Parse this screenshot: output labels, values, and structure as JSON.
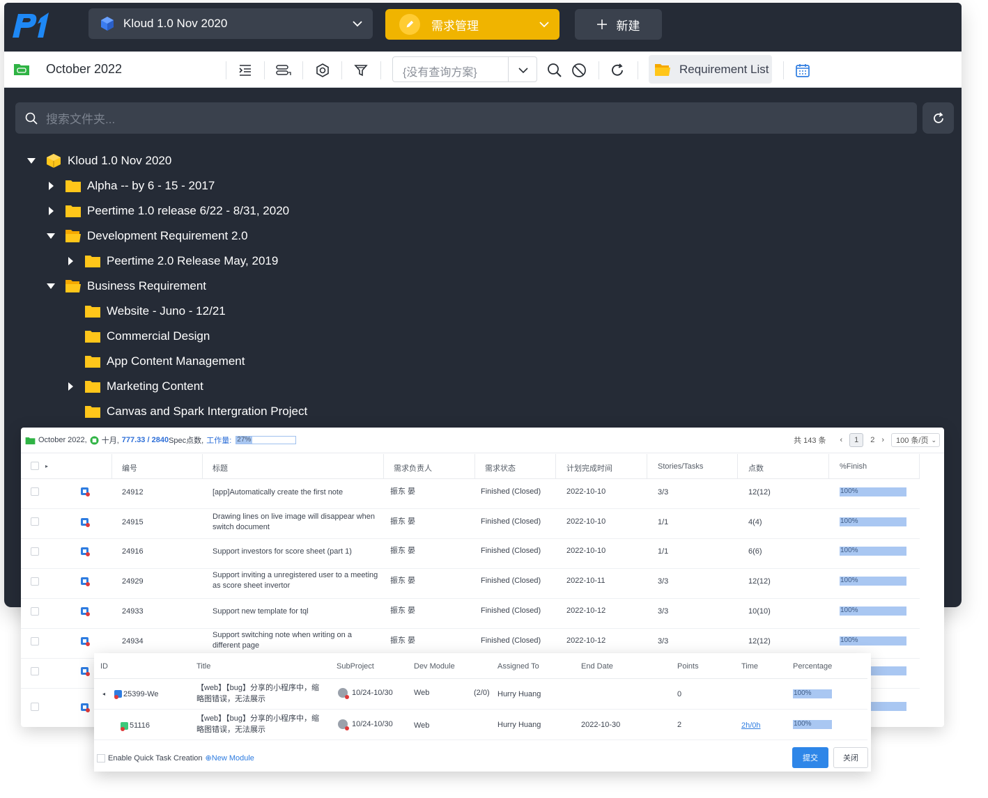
{
  "header": {
    "project": "Kloud 1.0 Nov 2020",
    "module": "需求管理",
    "new_label": "新建"
  },
  "toolbar": {
    "title": "October 2022",
    "query_placeholder": "{没有查询方案}",
    "requirement_list": "Requirement List"
  },
  "search": {
    "placeholder": "搜索文件夹..."
  },
  "tree": {
    "root": "Kloud 1.0 Nov 2020",
    "n1": "Alpha -- by 6 - 15 - 2017",
    "n2": "Peertime 1.0 release 6/22 - 8/31, 2020",
    "n3": "Development Requirement 2.0",
    "n4": "Peertime 2.0 Release May, 2019",
    "n5": "Business Requirement",
    "n6": "Website - Juno - 12/21",
    "n7": "Commercial Design",
    "n8": "App Content Management",
    "n9": "Marketing Content",
    "n10": "Canvas and Spark Intergration Project"
  },
  "panel": {
    "summary": {
      "title": "October 2022,",
      "month": "十月,",
      "points": "777.33 / 2840",
      "points_suffix": "Spec点数,",
      "workload_label": "工作量:",
      "workload_pct": "27%",
      "workload_value": 0.27
    },
    "pager": {
      "total": "共 143 条",
      "page1": "1",
      "page2": "2",
      "page_size": "100 条/页"
    },
    "columns": [
      "编号",
      "标题",
      "需求负责人",
      "需求状态",
      "计划完成时间",
      "Stories/Tasks",
      "点数",
      "%Finish"
    ],
    "rows": [
      {
        "id": "24912",
        "title": "[app]Automatically create the first note",
        "title2": "",
        "owner": "振东 晏",
        "status": "Finished (Closed)",
        "date": "2022-10-10",
        "st": "3/3",
        "pts": "12(12)",
        "finish": "100%"
      },
      {
        "id": "24915",
        "title": "Drawing lines on live image will disappear when",
        "title2": "switch document",
        "owner": "振东 晏",
        "status": "Finished (Closed)",
        "date": "2022-10-10",
        "st": "1/1",
        "pts": "4(4)",
        "finish": "100%"
      },
      {
        "id": "24916",
        "title": "Support investors for score sheet (part 1)",
        "title2": "",
        "owner": "振东 晏",
        "status": "Finished (Closed)",
        "date": "2022-10-10",
        "st": "1/1",
        "pts": "6(6)",
        "finish": "100%"
      },
      {
        "id": "24929",
        "title": "Support inviting a unregistered user to a meeting",
        "title2": "as score sheet invertor",
        "owner": "振东 晏",
        "status": "Finished (Closed)",
        "date": "2022-10-11",
        "st": "3/3",
        "pts": "12(12)",
        "finish": "100%"
      },
      {
        "id": "24933",
        "title": "Support new template for tql",
        "title2": "",
        "owner": "振东 晏",
        "status": "Finished (Closed)",
        "date": "2022-10-12",
        "st": "3/3",
        "pts": "10(10)",
        "finish": "100%"
      },
      {
        "id": "24934",
        "title": "Support switching note when writing on a",
        "title2": "different page",
        "owner": "振东 晏",
        "status": "Finished (Closed)",
        "date": "2022-10-12",
        "st": "3/3",
        "pts": "12(12)",
        "finish": "100%"
      }
    ]
  },
  "subtasks": {
    "columns": [
      "ID",
      "Title",
      "SubProject",
      "Dev Module",
      "Assigned To",
      "End Date",
      "Points",
      "Time",
      "Percentage"
    ],
    "rows": [
      {
        "id": "25399-We",
        "title": "【web】【bug】分享的小程序中，缩",
        "title2": "略图错误，无法展示",
        "sub": "10/24-10/30",
        "module": "Web",
        "count": "(2/0)",
        "assigned": "Hurry Huang",
        "end": "",
        "points": "0",
        "time": "",
        "pct": "100%"
      },
      {
        "id": "51116",
        "title": "【web】【bug】分享的小程序中，缩",
        "title2": "略图错误，无法展示",
        "sub": "10/24-10/30",
        "module": "Web",
        "count": "",
        "assigned": "Hurry Huang",
        "end": "2022-10-30",
        "points": "2",
        "time": "2h/0h",
        "pct": "100%"
      }
    ],
    "quick_create": "Enable Quick Task Creation",
    "new_module": "New Module",
    "submit": "提交",
    "close": "关闭"
  },
  "colors": {
    "dark_bg": "#252b36",
    "accent_yellow": "#f0b400",
    "brand_blue": "#1e88f5",
    "folder_yellow": "#ffc61a",
    "progress_blue": "#a9c7f2",
    "primary_button": "#2e86e8"
  }
}
